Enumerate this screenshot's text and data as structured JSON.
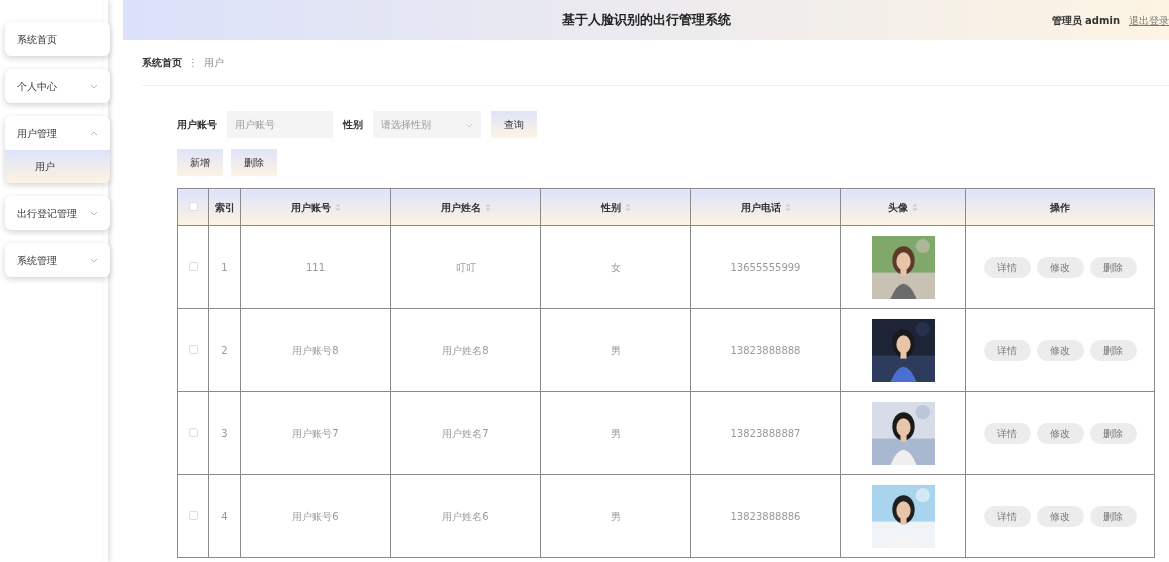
{
  "header": {
    "title": "基于人脸识别的出行管理系统",
    "user": "管理员 admin",
    "logout": "退出登录"
  },
  "sidebar": {
    "items": [
      {
        "label": "系统首页",
        "expandable": false
      },
      {
        "label": "个人中心",
        "expandable": true,
        "expanded": false
      },
      {
        "label": "用户管理",
        "expandable": true,
        "expanded": true,
        "children": [
          {
            "label": "用户",
            "selected": true
          }
        ]
      },
      {
        "label": "出行登记管理",
        "expandable": true,
        "expanded": false
      },
      {
        "label": "系统管理",
        "expandable": true,
        "expanded": false
      }
    ]
  },
  "breadcrumb_separator": "⋮",
  "breadcrumb": [
    {
      "label": "系统首页",
      "current": false
    },
    {
      "label": "用户",
      "current": true
    }
  ],
  "search": {
    "fields": [
      {
        "kind": "input",
        "label": "用户账号",
        "placeholder": "用户账号"
      },
      {
        "kind": "select",
        "label": "性别",
        "placeholder": "请选择性别"
      }
    ],
    "button": "查询"
  },
  "actions": [
    "新增",
    "删除"
  ],
  "table": {
    "select_all": {
      "checked": false
    },
    "columns": [
      {
        "label": "索引",
        "sortable": false
      },
      {
        "label": "用户账号",
        "sortable": true
      },
      {
        "label": "用户姓名",
        "sortable": true
      },
      {
        "label": "性别",
        "sortable": true
      },
      {
        "label": "用户电话",
        "sortable": true
      },
      {
        "label": "头像",
        "sortable": true
      },
      {
        "label": "操作",
        "sortable": false
      }
    ],
    "rows": [
      {
        "checked": false,
        "index": "1",
        "account": "111",
        "name": "叮叮",
        "gender": "女",
        "phone": "13655555999",
        "avatar": {
          "kind": "picture"
        },
        "buttons": [
          "详情",
          "修改",
          "删除"
        ]
      },
      {
        "checked": false,
        "index": "2",
        "account": "用户账号8",
        "name": "用户姓名8",
        "gender": "男",
        "phone": "13823888888",
        "avatar": {
          "kind": "picture"
        },
        "buttons": [
          "详情",
          "修改",
          "删除"
        ]
      },
      {
        "checked": false,
        "index": "3",
        "account": "用户账号7",
        "name": "用户姓名7",
        "gender": "男",
        "phone": "13823888887",
        "avatar": {
          "kind": "picture"
        },
        "buttons": [
          "详情",
          "修改",
          "删除"
        ]
      },
      {
        "checked": false,
        "index": "4",
        "account": "用户账号6",
        "name": "用户姓名6",
        "gender": "男",
        "phone": "13823888886",
        "avatar": {
          "kind": "picture"
        },
        "buttons": [
          "详情",
          "修改",
          "删除"
        ]
      }
    ]
  }
}
